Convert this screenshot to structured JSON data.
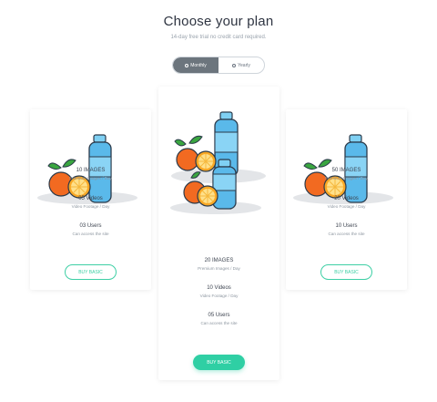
{
  "header": {
    "title": "Choose your plan",
    "subtitle": "14-day free trial no credit card required."
  },
  "toggle": {
    "options": [
      {
        "label": "Monthly",
        "active": true
      },
      {
        "label": "Yearly",
        "active": false
      }
    ]
  },
  "plans": [
    {
      "features": [
        {
          "main": "10 IMAGES",
          "sub": "Premium Images / Day"
        },
        {
          "main": "05 Videos",
          "sub": "Video Footage / Day"
        },
        {
          "main": "03 Users",
          "sub": "Can access the site"
        }
      ],
      "button": "BUY BASIC"
    },
    {
      "features": [
        {
          "main": "20 IMAGES",
          "sub": "Premium Images / Day"
        },
        {
          "main": "10 Videos",
          "sub": "Video Footage / Day"
        },
        {
          "main": "05 Users",
          "sub": "Can access the site"
        }
      ],
      "button": "BUY BASIC"
    },
    {
      "features": [
        {
          "main": "50 IMAGES",
          "sub": "Premium Images / Day"
        },
        {
          "main": "20 Videos",
          "sub": "Video Footage / Day"
        },
        {
          "main": "10 Users",
          "sub": "Can access the site"
        }
      ],
      "button": "BUY BASIC"
    }
  ],
  "colors": {
    "accent": "#2fcfa4",
    "toggle_active": "#6c757d",
    "bottle": "#53b6ea",
    "orange": "#f26a21",
    "leaf": "#3aa640"
  },
  "icons": [
    "water-bottle-icon",
    "orange-icon",
    "orange-slice-icon",
    "leaf-icon"
  ]
}
